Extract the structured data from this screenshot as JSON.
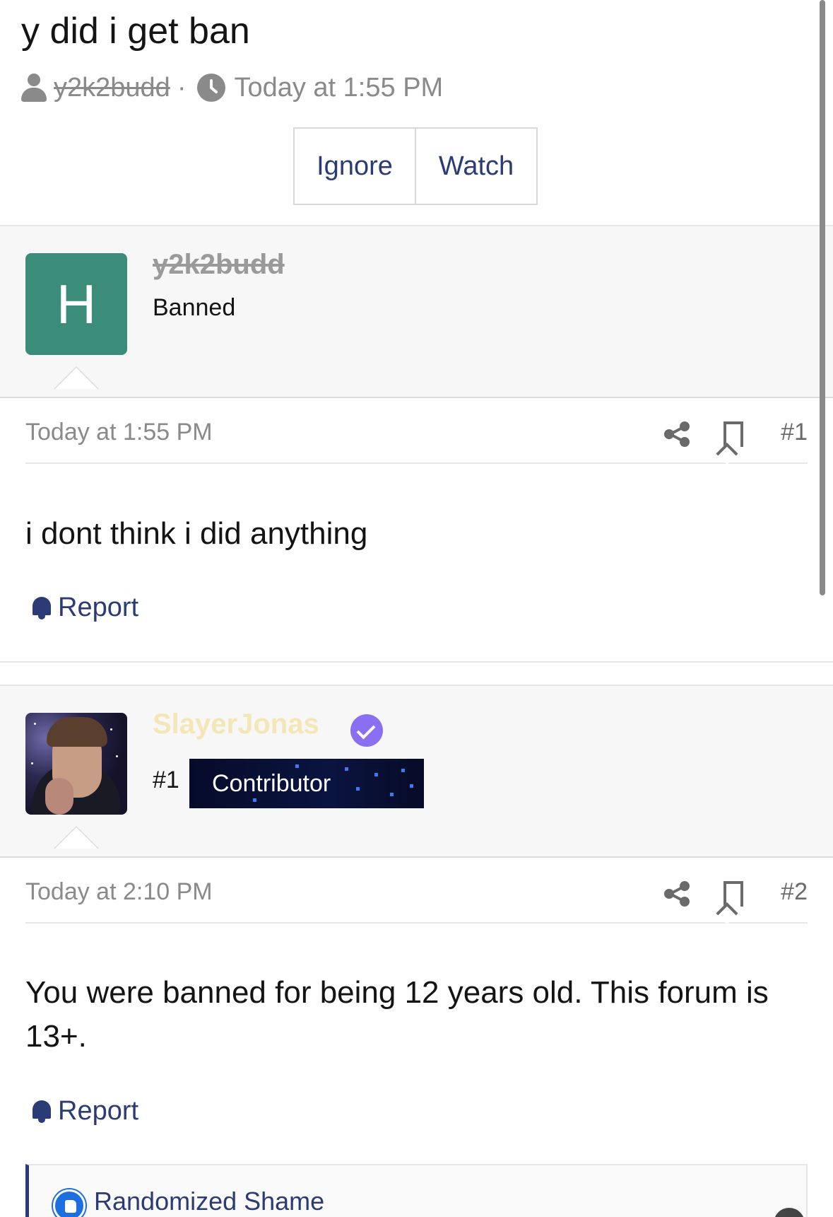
{
  "thread": {
    "title": "y did i get ban",
    "author": "y2k2budd",
    "separator": "·",
    "time": "Today at 1:55 PM",
    "ignore_label": "Ignore",
    "watch_label": "Watch"
  },
  "posts": [
    {
      "avatar_letter": "H",
      "username": "y2k2budd",
      "user_title": "Banned",
      "time": "Today at 1:55 PM",
      "number": "#1",
      "body": "i dont think i did anything",
      "report_label": "Report"
    },
    {
      "username": "SlayerJonas",
      "rank": "#1",
      "banner_label": "Contributor",
      "time": "Today at 2:10 PM",
      "number": "#2",
      "body": "You were banned for being 12 years old. This forum is 13+.",
      "report_label": "Report",
      "reaction_label": "Randomized Shame"
    }
  ],
  "icons": [
    "user-icon",
    "clock-icon",
    "share-icon",
    "bookmark-icon",
    "bell-icon",
    "like-icon",
    "verified-icon"
  ],
  "colors": {
    "link": "#2b3b75",
    "avatar_bg": "#3b8c79",
    "verified": "#8a6ff0",
    "muted": "#8a8a8a",
    "like": "#1c6fe0"
  }
}
